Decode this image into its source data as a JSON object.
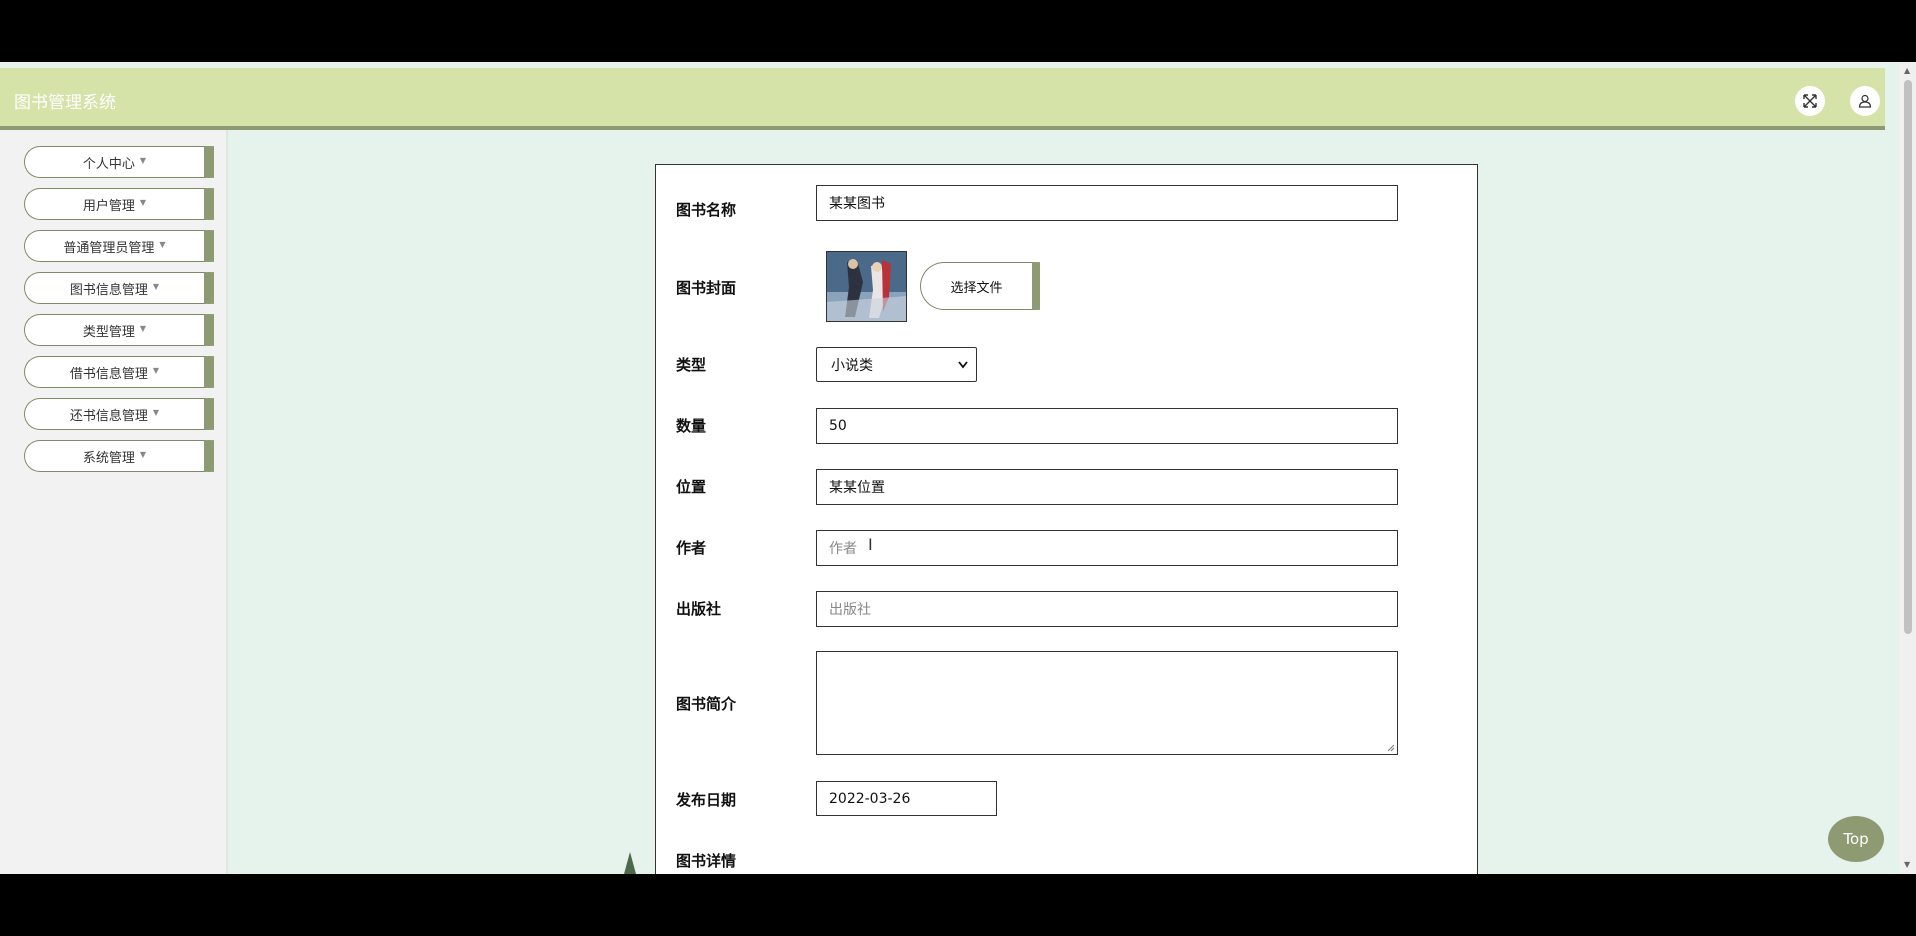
{
  "header": {
    "title": "图书管理系统",
    "fullscreen_icon": "fullscreen-icon",
    "user_icon": "user-icon"
  },
  "sidebar": {
    "items": [
      {
        "label": "个人中心"
      },
      {
        "label": "用户管理"
      },
      {
        "label": "普通管理员管理"
      },
      {
        "label": "图书信息管理"
      },
      {
        "label": "类型管理"
      },
      {
        "label": "借书信息管理"
      },
      {
        "label": "还书信息管理"
      },
      {
        "label": "系统管理"
      }
    ],
    "caret": "▼"
  },
  "form": {
    "book_name_label": "图书名称",
    "book_name_value": "某某图书",
    "cover_label": "图书封面",
    "file_button_label": "选择文件",
    "type_label": "类型",
    "type_value": "小说类",
    "quantity_label": "数量",
    "quantity_value": "50",
    "location_label": "位置",
    "location_value": "某某位置",
    "author_label": "作者",
    "author_placeholder": "作者",
    "publisher_label": "出版社",
    "publisher_placeholder": "出版社",
    "intro_label": "图书简介",
    "date_label": "发布日期",
    "date_value": "2022-03-26",
    "detail_label": "图书详情"
  },
  "top_button": "Top",
  "colors": {
    "header_bg": "#d5e2a8",
    "accent": "#8e9a72",
    "page_bg": "#e6f2ec",
    "sidebar_bg": "#f2f2f2"
  }
}
